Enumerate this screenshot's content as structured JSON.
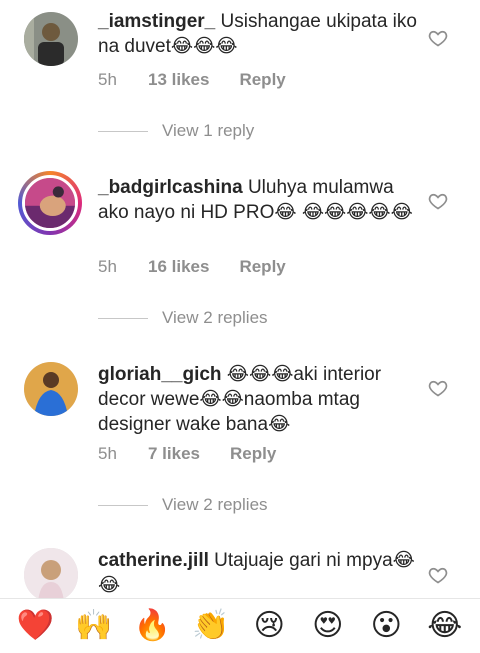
{
  "comments": [
    {
      "username": "_iamstinger_",
      "text": " Usishangae ukipata iko na duvet😂😂😂",
      "time": "5h",
      "likes": "13 likes",
      "reply": "Reply",
      "view_replies": "View 1 reply",
      "avatar_colors": [
        "#6e5a3e",
        "#2b2b2b"
      ]
    },
    {
      "username": "_badgirlcashina",
      "text": " Uluhya mulamwa ako nayo ni HD PRO😂 😂😂😂😂😂",
      "time": "5h",
      "likes": "16 likes",
      "reply": "Reply",
      "view_replies": "View 2 replies",
      "avatar_colors": [
        "#c64a8a",
        "#6b2a6e"
      ]
    },
    {
      "username": "gloriah__gich",
      "text": " 😂😂😂aki interior decor wewe😂😂naomba mtag designer wake bana😂",
      "time": "5h",
      "likes": "7 likes",
      "reply": "Reply",
      "view_replies": "View 2 replies",
      "avatar_colors": [
        "#2a6fd6",
        "#e0a64a"
      ]
    },
    {
      "username": "catherine.jill",
      "text": " Utajuaje gari ni mpya😂😂",
      "avatar_colors": [
        "#f0e6ea",
        "#c9a07a"
      ]
    }
  ],
  "reactions": [
    "❤️",
    "🙌",
    "🔥",
    "👏",
    "😢",
    "😍",
    "😮",
    "😂"
  ],
  "colors": {
    "text": "#262626",
    "secondary": "#8e8e8e",
    "heart_red": "#ed4956"
  }
}
